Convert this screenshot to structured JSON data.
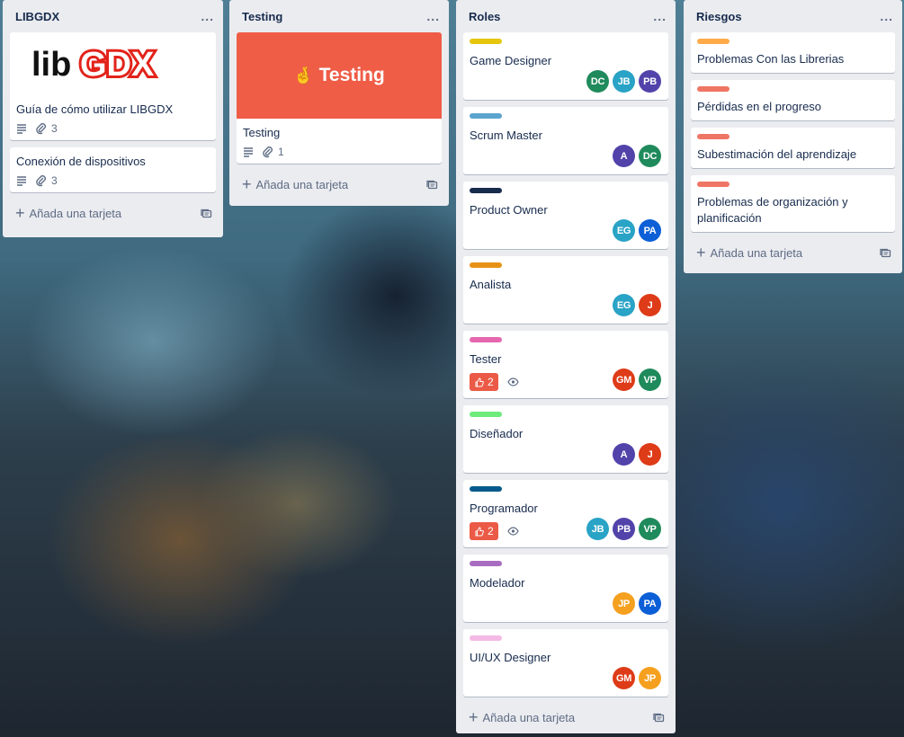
{
  "lists": [
    {
      "title": "LIBGDX",
      "menu": "...",
      "add_card": "Añada una tarjeta",
      "cards": [
        {
          "cover_logo": "libGDX",
          "title": "Guía de cómo utilizar LIBGDX",
          "attachments": "3"
        },
        {
          "title": "Conexión de dispositivos",
          "attachments": "3"
        }
      ]
    },
    {
      "title": "Testing",
      "menu": "...",
      "add_card": "Añada una tarjeta",
      "cards": [
        {
          "cover_text": "Testing",
          "cover_emoji": "🤞",
          "cover_color": "#ef5d47",
          "title": "Testing",
          "attachments": "1"
        }
      ]
    },
    {
      "title": "Roles",
      "menu": "...",
      "add_card": "Añada una tarjeta",
      "cards": [
        {
          "label_color": "#e6c60d",
          "title": "Game Designer",
          "members": [
            "DC",
            "JB",
            "PB"
          ]
        },
        {
          "label_color": "#5ba4cf",
          "title": "Scrum Master",
          "members": [
            "A",
            "DC"
          ]
        },
        {
          "label_color": "#172b4d",
          "title": "Product Owner",
          "members": [
            "EG",
            "PA"
          ]
        },
        {
          "label_color": "#e79217",
          "title": "Analista",
          "members": [
            "EG",
            "J"
          ]
        },
        {
          "label_color": "#e568af",
          "title": "Tester",
          "votes": "2",
          "members": [
            "GM",
            "VP"
          ]
        },
        {
          "label_color": "#6deb7b",
          "title": "Diseñador",
          "members": [
            "A",
            "J"
          ]
        },
        {
          "label_color": "#055a8c",
          "title": "Programador",
          "votes": "2",
          "members": [
            "JB",
            "PB",
            "VP"
          ]
        },
        {
          "label_color": "#a86cc1",
          "title": "Modelador",
          "members": [
            "JP",
            "PA"
          ]
        },
        {
          "label_color": "#f4b9e4",
          "title": "UI/UX Designer",
          "members": [
            "GM",
            "JP"
          ]
        }
      ]
    },
    {
      "title": "Riesgos",
      "menu": "...",
      "add_card": "Añada una tarjeta",
      "cards": [
        {
          "label_color": "#ffab4a",
          "title": "Problemas Con las Librerias"
        },
        {
          "label_color": "#ef7564",
          "title": "Pérdidas en el progreso"
        },
        {
          "label_color": "#ef7564",
          "title": "Subestimación del aprendizaje"
        },
        {
          "label_color": "#ef7564",
          "title": "Problemas de organización y planificación"
        }
      ]
    }
  ],
  "member_colors": {
    "DC": "#1f8a5b",
    "JB": "#29a3c6",
    "PB": "#5243aa",
    "A": "#5243aa",
    "EG": "#29a3c6",
    "PA": "#0c5fd6",
    "J": "#de3b18",
    "GM": "#de3b18",
    "VP": "#1f8a5b",
    "JP": "#f5a01f"
  },
  "icons": {
    "description": "lines-icon",
    "attachment": "paperclip-icon",
    "vote": "thumbs-up-icon",
    "watch": "eye-icon",
    "template": "card-template-icon",
    "add": "plus-icon"
  }
}
